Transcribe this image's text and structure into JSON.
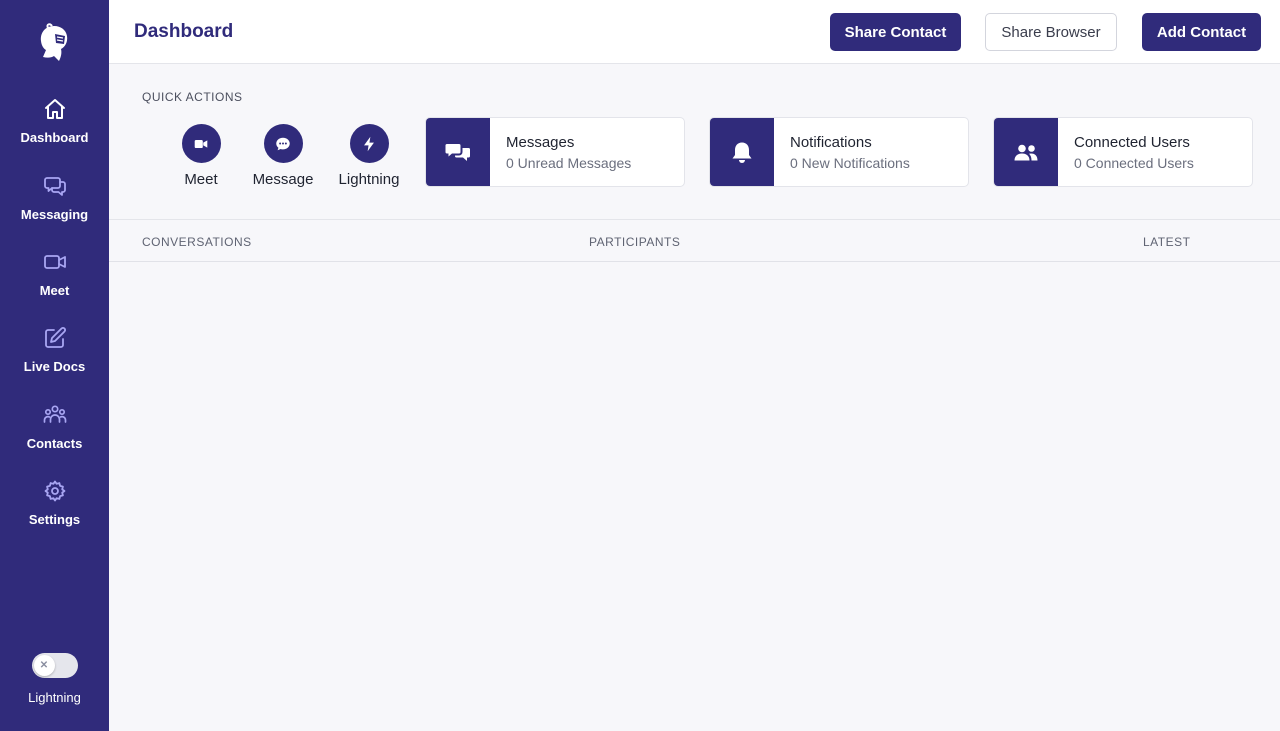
{
  "sidebar": {
    "items": [
      {
        "label": "Dashboard",
        "icon": "home-icon"
      },
      {
        "label": "Messaging",
        "icon": "chat-bubbles-icon"
      },
      {
        "label": "Meet",
        "icon": "video-camera-icon"
      },
      {
        "label": "Live Docs",
        "icon": "edit-document-icon"
      },
      {
        "label": "Contacts",
        "icon": "user-group-icon"
      },
      {
        "label": "Settings",
        "icon": "gear-icon"
      }
    ],
    "toggle": {
      "label": "Lightning",
      "state": "off"
    }
  },
  "header": {
    "title": "Dashboard",
    "buttons": {
      "share_contact": "Share Contact",
      "share_browser": "Share Browser",
      "add_contact": "Add Contact"
    }
  },
  "quick_actions": {
    "title": "QUICK ACTIONS",
    "items": [
      {
        "label": "Meet",
        "icon": "video-camera-icon"
      },
      {
        "label": "Message",
        "icon": "chat-dots-icon"
      },
      {
        "label": "Lightning",
        "icon": "lightning-bolt-icon"
      }
    ]
  },
  "stats": [
    {
      "title": "Messages",
      "subtitle": "0 Unread Messages",
      "icon": "chat-bubbles-icon"
    },
    {
      "title": "Notifications",
      "subtitle": "0 New Notifications",
      "icon": "bell-icon"
    },
    {
      "title": "Connected Users",
      "subtitle": "0 Connected Users",
      "icon": "users-icon"
    }
  ],
  "table": {
    "columns": [
      "CONVERSATIONS",
      "PARTICIPANTS",
      "LATEST"
    ]
  },
  "colors": {
    "brand": "#302b7b",
    "nav_icon": "#a9a6f3",
    "background": "#f7f7fa"
  }
}
